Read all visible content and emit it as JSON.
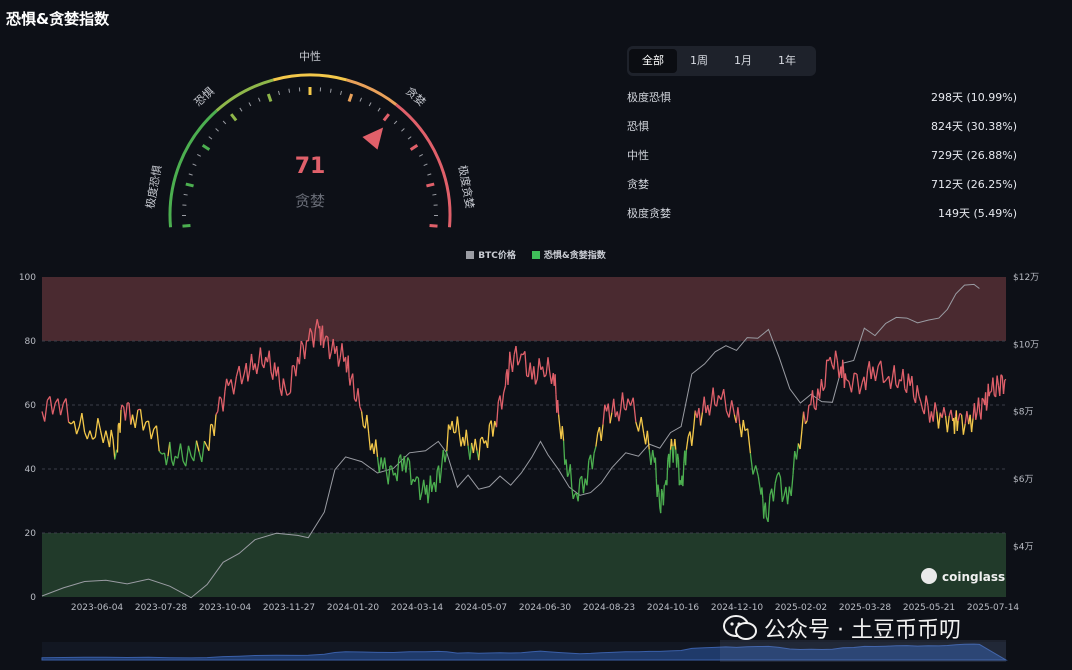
{
  "page": {
    "title": "恐惧&贪婪指数"
  },
  "gauge": {
    "value": "71",
    "state": "贪婪",
    "labels": [
      "极度恐惧",
      "恐惧",
      "中性",
      "贪婪",
      "极度贪婪"
    ],
    "value_num": 71
  },
  "tabs": [
    {
      "label": "全部",
      "active": true
    },
    {
      "label": "1周",
      "active": false
    },
    {
      "label": "1月",
      "active": false
    },
    {
      "label": "1年",
      "active": false
    }
  ],
  "stats": [
    {
      "label": "极度恐惧",
      "value": "298天 (10.99%)"
    },
    {
      "label": "恐惧",
      "value": "824天 (30.38%)"
    },
    {
      "label": "中性",
      "value": "729天 (26.88%)"
    },
    {
      "label": "贪婪",
      "value": "712天 (26.25%)"
    },
    {
      "label": "极度贪婪",
      "value": "149天 (5.49%)"
    }
  ],
  "legend": [
    {
      "name": "BTC价格",
      "color": "#9a9ca3"
    },
    {
      "name": "恐惧&贪婪指数",
      "color": "#3fbf5a"
    }
  ],
  "watermark": {
    "brand": "coinglass",
    "text": "公众号 · 土豆币币叨"
  },
  "colors": {
    "extreme_fear": "#4caf50",
    "neutral": "#f4c84a",
    "greed": "#e0606a",
    "btc": "#9a9ca3",
    "bg": "#0d1017"
  },
  "chart_data": {
    "type": "line",
    "x_labels": [
      "2023-06-04",
      "2023-07-28",
      "2023-10-04",
      "2023-11-27",
      "2024-01-20",
      "2024-03-14",
      "2024-05-07",
      "2024-06-30",
      "2024-08-23",
      "2024-10-16",
      "2024-12-10",
      "2025-02-02",
      "2025-03-28",
      "2025-05-21",
      "2025-07-14"
    ],
    "y_left_ticks": [
      "0",
      "20",
      "40",
      "60",
      "80",
      "100"
    ],
    "y_left_range": [
      0,
      100
    ],
    "y_right_ticks": [
      "$4万",
      "$6万",
      "$8万",
      "$10万",
      "$12万"
    ],
    "y_right_range": [
      25000,
      120000
    ],
    "bands": [
      {
        "from": 80,
        "to": 100,
        "color": "#4a2a30"
      },
      {
        "from": 0,
        "to": 20,
        "color": "#213a2a"
      }
    ],
    "series": [
      {
        "name": "恐惧&贪婪指数",
        "values": [
          [
            0,
            58
          ],
          [
            15,
            62
          ],
          [
            30,
            55
          ],
          [
            45,
            52
          ],
          [
            60,
            52
          ],
          [
            70,
            46
          ],
          [
            75,
            60
          ],
          [
            85,
            57
          ],
          [
            100,
            55
          ],
          [
            115,
            45
          ],
          [
            125,
            44
          ],
          [
            140,
            44
          ],
          [
            155,
            47
          ],
          [
            165,
            58
          ],
          [
            175,
            66
          ],
          [
            190,
            70
          ],
          [
            200,
            73
          ],
          [
            210,
            75
          ],
          [
            220,
            69
          ],
          [
            230,
            63
          ],
          [
            240,
            75
          ],
          [
            250,
            80
          ],
          [
            260,
            84
          ],
          [
            265,
            80
          ],
          [
            275,
            76
          ],
          [
            285,
            75
          ],
          [
            290,
            68
          ],
          [
            300,
            58
          ],
          [
            310,
            48
          ],
          [
            320,
            40
          ],
          [
            330,
            38
          ],
          [
            340,
            44
          ],
          [
            350,
            36
          ],
          [
            360,
            32
          ],
          [
            367,
            35
          ],
          [
            375,
            40
          ],
          [
            385,
            55
          ],
          [
            395,
            50
          ],
          [
            405,
            45
          ],
          [
            415,
            48
          ],
          [
            425,
            55
          ],
          [
            435,
            66
          ],
          [
            440,
            74
          ],
          [
            450,
            76
          ],
          [
            460,
            68
          ],
          [
            470,
            72
          ],
          [
            480,
            70
          ],
          [
            485,
            57
          ],
          [
            492,
            43
          ],
          [
            500,
            32
          ],
          [
            510,
            37
          ],
          [
            520,
            47
          ],
          [
            530,
            58
          ],
          [
            540,
            58
          ],
          [
            550,
            62
          ],
          [
            565,
            51
          ],
          [
            575,
            42
          ],
          [
            580,
            28
          ],
          [
            585,
            35
          ],
          [
            590,
            46
          ],
          [
            595,
            46
          ],
          [
            600,
            35
          ],
          [
            605,
            46
          ],
          [
            615,
            56
          ],
          [
            625,
            60
          ],
          [
            635,
            63
          ],
          [
            650,
            57
          ],
          [
            660,
            52
          ],
          [
            675,
            32
          ],
          [
            680,
            25
          ],
          [
            690,
            38
          ],
          [
            700,
            29
          ],
          [
            710,
            48
          ],
          [
            720,
            60
          ],
          [
            730,
            62
          ],
          [
            740,
            75
          ],
          [
            750,
            72
          ],
          [
            755,
            68
          ],
          [
            770,
            67
          ],
          [
            780,
            72
          ],
          [
            795,
            69
          ],
          [
            805,
            68
          ],
          [
            815,
            66
          ],
          [
            825,
            61
          ],
          [
            835,
            58
          ],
          [
            845,
            56
          ],
          [
            855,
            55
          ],
          [
            860,
            55
          ],
          [
            870,
            54
          ],
          [
            878,
            58
          ],
          [
            885,
            60
          ],
          [
            890,
            64
          ],
          [
            898,
            66
          ],
          [
            905,
            68
          ]
        ]
      },
      {
        "name": "BTC价格",
        "values": [
          [
            0,
            26500
          ],
          [
            20,
            28500
          ],
          [
            40,
            30000
          ],
          [
            60,
            30000
          ],
          [
            80,
            28500
          ],
          [
            100,
            29500
          ],
          [
            120,
            27000
          ],
          [
            140,
            26000
          ],
          [
            155,
            27500
          ],
          [
            170,
            34500
          ],
          [
            185,
            37500
          ],
          [
            200,
            42000
          ],
          [
            220,
            43500
          ],
          [
            240,
            42500
          ],
          [
            250,
            43000
          ],
          [
            265,
            51000
          ],
          [
            275,
            62000
          ],
          [
            285,
            67000
          ],
          [
            300,
            66000
          ],
          [
            315,
            63000
          ],
          [
            330,
            62000
          ],
          [
            345,
            67000
          ],
          [
            360,
            68000
          ],
          [
            372,
            70000
          ],
          [
            380,
            67000
          ],
          [
            390,
            58000
          ],
          [
            400,
            60000
          ],
          [
            410,
            57000
          ],
          [
            420,
            59000
          ],
          [
            430,
            60500
          ],
          [
            440,
            59000
          ],
          [
            450,
            61000
          ],
          [
            460,
            67000
          ],
          [
            468,
            72000
          ],
          [
            475,
            68000
          ],
          [
            485,
            62000
          ],
          [
            495,
            58000
          ],
          [
            505,
            54000
          ],
          [
            515,
            56000
          ],
          [
            525,
            60000
          ],
          [
            535,
            63000
          ],
          [
            548,
            67000
          ],
          [
            560,
            68000
          ],
          [
            570,
            70000
          ],
          [
            580,
            70000
          ],
          [
            590,
            73000
          ],
          [
            600,
            76000
          ],
          [
            610,
            90000
          ],
          [
            622,
            95000
          ],
          [
            632,
            97000
          ],
          [
            642,
            100000
          ],
          [
            652,
            97000
          ],
          [
            662,
            102000
          ],
          [
            672,
            103000
          ],
          [
            682,
            104000
          ],
          [
            692,
            97000
          ],
          [
            702,
            86000
          ],
          [
            712,
            83000
          ],
          [
            722,
            84000
          ],
          [
            732,
            83000
          ],
          [
            742,
            84000
          ],
          [
            752,
            94000
          ],
          [
            762,
            96000
          ],
          [
            772,
            104000
          ],
          [
            782,
            103000
          ],
          [
            792,
            105000
          ],
          [
            802,
            108000
          ],
          [
            812,
            109000
          ],
          [
            822,
            106000
          ],
          [
            832,
            108000
          ],
          [
            842,
            107000
          ],
          [
            850,
            110000
          ],
          [
            858,
            115000
          ],
          [
            866,
            118000
          ],
          [
            875,
            119000
          ],
          [
            880,
            117000
          ]
        ]
      }
    ],
    "sentiment_thresholds": {
      "extreme_fear": 25,
      "fear": 46,
      "neutral": 56,
      "greed": 76
    }
  }
}
